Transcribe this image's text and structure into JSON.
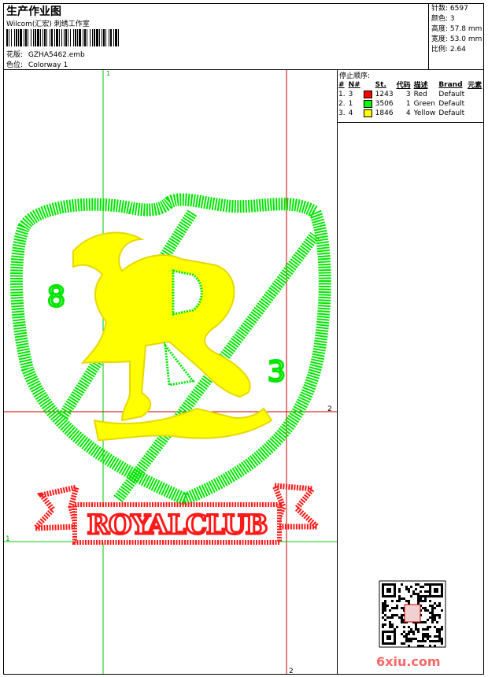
{
  "header": {
    "title": "生产作业图",
    "subtitle": "Wilcom(汇宏) 刺绣工作室",
    "design_label": "花版:",
    "design_value": "GZHA5462.emb",
    "colorway_label": "色位:",
    "colorway_value": "Colorway 1"
  },
  "stats": [
    {
      "label": "针数:",
      "value": "6597"
    },
    {
      "label": "颜色:",
      "value": "3"
    },
    {
      "label": "高度:",
      "value": "57.8 mm"
    },
    {
      "label": "宽度:",
      "value": "53.0 mm"
    },
    {
      "label": "比例:",
      "value": "2.64"
    }
  ],
  "stop_sequence": {
    "title": "停止顺序:",
    "headers": [
      "#",
      "N#",
      "St.",
      "代码",
      "描述",
      "Brand",
      "元素"
    ],
    "rows": [
      {
        "idx": "1.",
        "n": "3",
        "st": "1243",
        "code": "3",
        "desc": "Red",
        "brand": "Default",
        "color": "#ff0000"
      },
      {
        "idx": "2.",
        "n": "1",
        "st": "3506",
        "code": "1",
        "desc": "Green",
        "brand": "Default",
        "color": "#00ff00"
      },
      {
        "idx": "3.",
        "n": "4",
        "st": "1846",
        "code": "4",
        "desc": "Yellow",
        "brand": "Default",
        "color": "#ffff00"
      }
    ]
  },
  "guides": {
    "v1": "1",
    "v2": "2",
    "h1": "1",
    "h2": "2"
  },
  "design": {
    "num_left": "8",
    "num_right": "3",
    "banner_text": "ROYALCLUB"
  },
  "watermark": "6xiu.com",
  "colors": {
    "red": "#ff0000",
    "green": "#00ff00",
    "yellow": "#ffff00",
    "guide_green": "#00cc00",
    "guide_red": "#cc0000"
  }
}
